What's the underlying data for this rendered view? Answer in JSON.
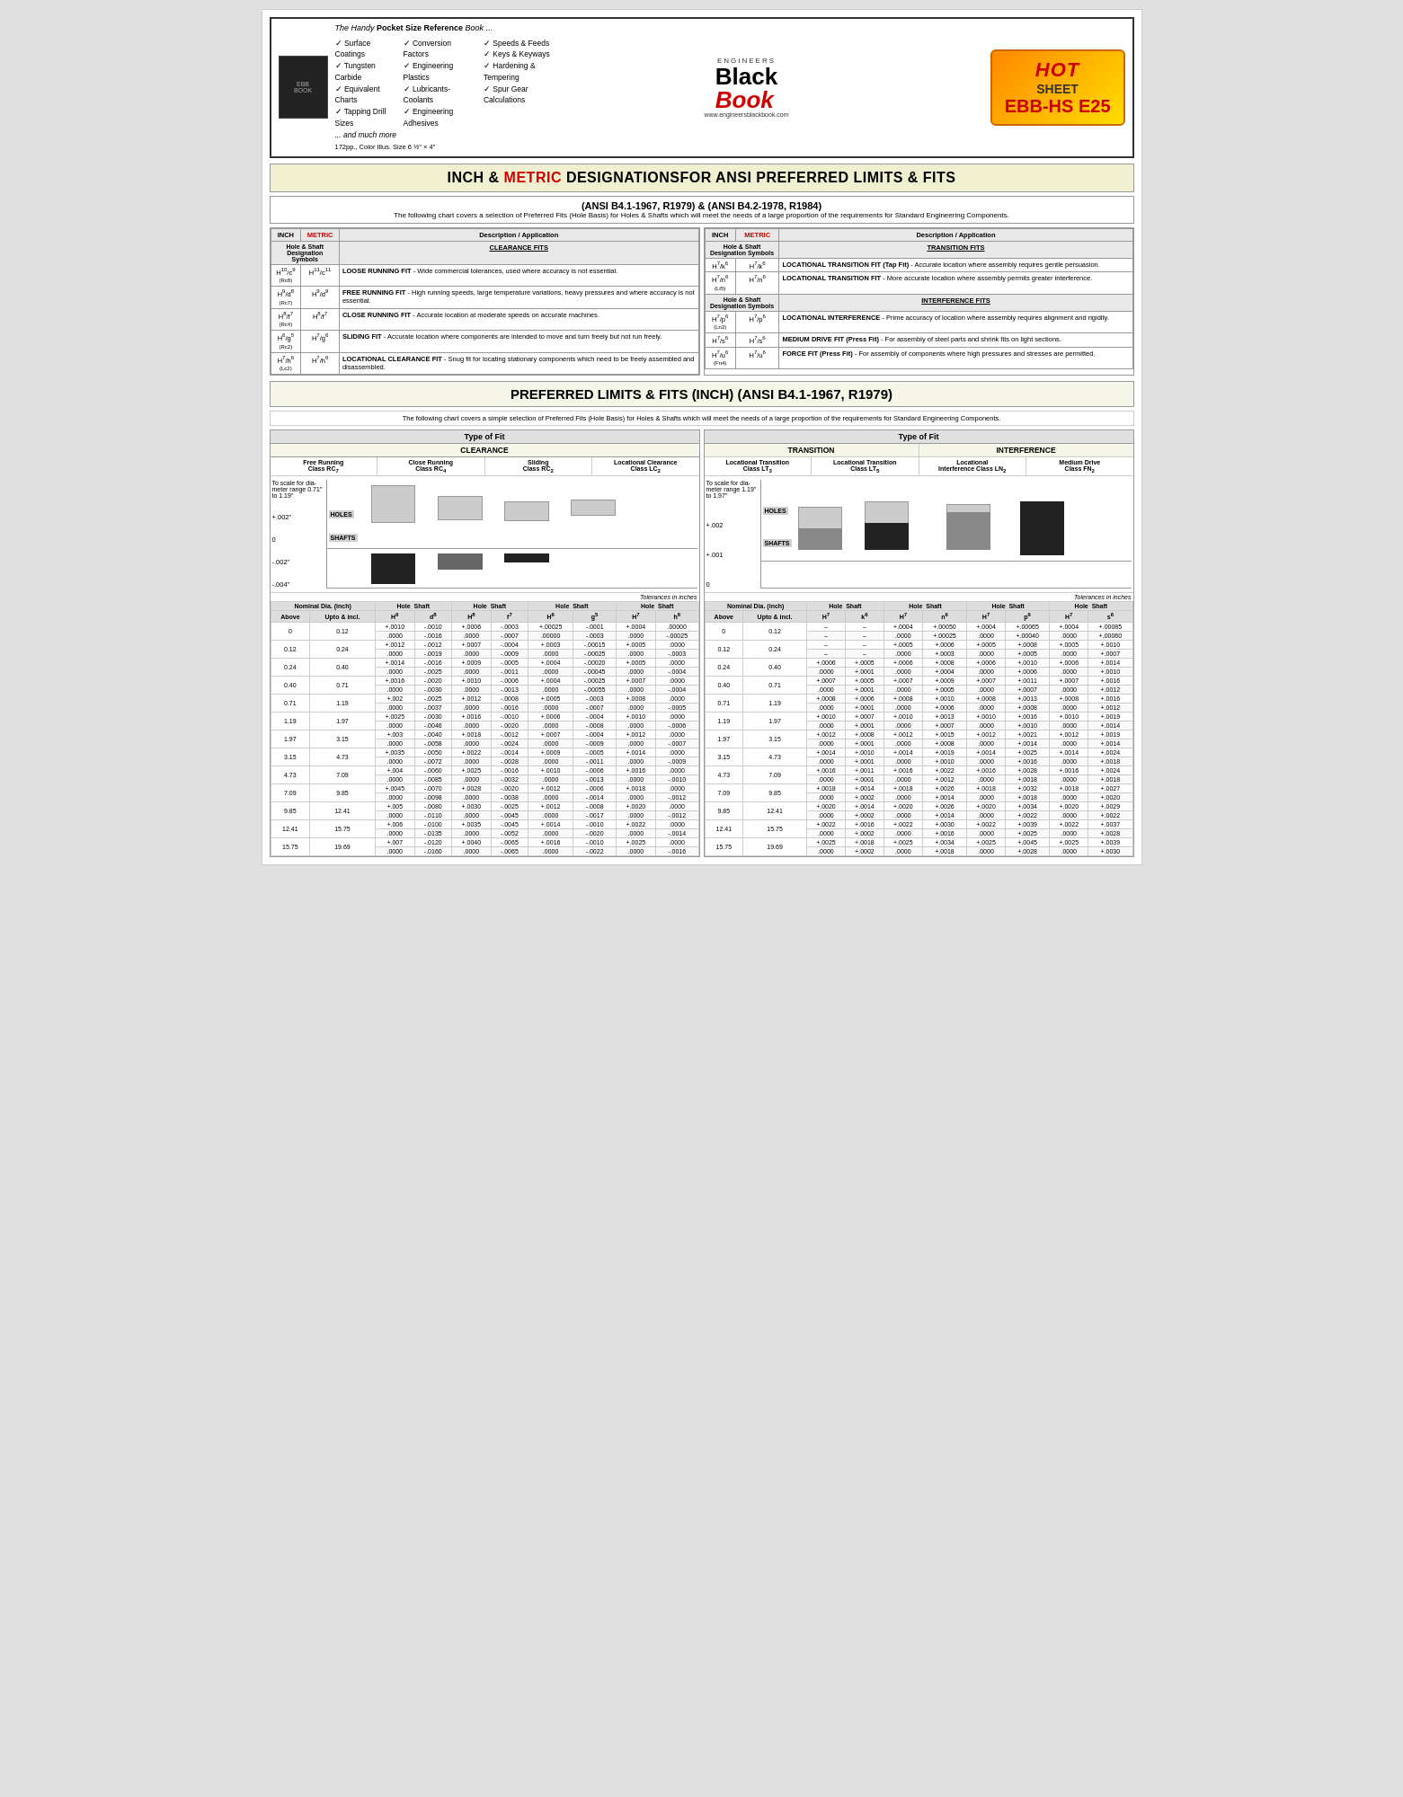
{
  "header": {
    "book_title": "The Handy Pocket Size Reference Book ...",
    "handy": "The Handy",
    "pocket": "Pocket Size Reference",
    "book": "Book",
    "col1": [
      "Surface Coatings",
      "Tungsten Carbide",
      "Equivalent Charts",
      "Tapping Drill Sizes"
    ],
    "col2": [
      "Conversion Factors",
      "Engineering Plastics",
      "Lubricants-Coolants",
      "Engineering Adhesives"
    ],
    "col3": [
      "Speeds & Feeds",
      "Keys & Keyways",
      "Hardening & Tempering",
      "Spur Gear Calculations"
    ],
    "col4_more": "... and much more",
    "pages": "172pp., Color Illus. Size 6 ½\" × 4\"",
    "engineers": "ENGINEERS",
    "black": "Black",
    "book_logo": "Book",
    "website": "www.engineersblackbook.com",
    "hot": "HOT",
    "sheet": "SHEET",
    "ebb": "EBB-HS E25"
  },
  "main_title": {
    "part1": "INCH & ",
    "metric": "METRIC",
    "part2": "  DESIGNATIONS",
    "part3": "FOR ANSI PREFERRED LIMITS & FITS"
  },
  "ansi_header": {
    "line1": "(ANSI B4.1-1967, R1979) & (ANSI B4.2-1978, R1984)",
    "line2": "The following chart covers a selection of Preferred Fits (Hole Basis) for Holes & Shafts which will meet the needs of a large proportion of the requirements for Standard Engineering Components."
  },
  "clearance_table": {
    "col_headers": [
      "INCH",
      "METRIC",
      "Description / Application"
    ],
    "header": "CLEARANCE FITS",
    "rows": [
      {
        "inch1": "H10/c9",
        "inch2": "(Rc8)",
        "metric1": "H11/c11",
        "desc": "LOOSE RUNNING FIT - Wide commercial tolerances, used where accuracy is not essential."
      },
      {
        "inch1": "H9/d8",
        "inch2": "(Rc7)",
        "metric1": "H9/d9",
        "desc": "FREE RUNNING FIT - High running speeds, large temperature variations, heavy pressures and where accuracy is not essential."
      },
      {
        "inch1": "H8/f7",
        "inch2": "(Rc4)",
        "metric1": "H8/f7",
        "desc": "CLOSE RUNNING FIT - Accurate location at moderate speeds on accurate machines."
      },
      {
        "inch1": "H6/g5",
        "inch2": "(Rc2)",
        "metric1": "H7/g6",
        "desc": "SLIDING FIT - Accurate location where components are intended to move and turn freely but not run freely."
      },
      {
        "inch1": "H7/h6",
        "inch2": "(Lc2)",
        "metric1": "H7/h6",
        "desc": "LOCATIONAL CLEARANCE FIT - Snug fit for locating stationary components which need to be freely assembled and disassembled."
      }
    ]
  },
  "transition_table": {
    "header": "TRANSITION FITS",
    "rows": [
      {
        "inch1": "H7/k6",
        "inch2": "",
        "metric1": "H7/k6",
        "desc": "LOCATIONAL TRANSITION FIT (Tap Fit) - Accurate location where assembly requires gentle persuasion."
      },
      {
        "inch1": "H7/n6",
        "inch2": "(Lt5)",
        "metric1": "H7/n6",
        "desc": "LOCATIONAL TRANSITION FIT - More accurate location where assembly permits greater interference."
      }
    ]
  },
  "interference_table": {
    "header": "INTERFERENCE FITS",
    "rows": [
      {
        "inch1": "H7/p6",
        "inch2": "(Ln2)",
        "metric1": "H7/p6",
        "desc": "LOCATIONAL INTERFERENCE - Prime accuracy of location where assembly requires alignment and rigidity."
      },
      {
        "inch1": "H7/s6",
        "inch2": "",
        "metric1": "H7/s6",
        "desc": "MEDIUM DRIVE FIT (Press Fit) - For assembly of steel parts and shrink fits on light sections."
      },
      {
        "inch1": "H7/u6",
        "inch2": "(Fn4)",
        "metric1": "H7/u6",
        "desc": "FORCE FIT (Press Fit) - For assembly of components where high pressures and stresses are permitted."
      }
    ]
  },
  "pref_title": "PREFERRED LIMITS & FITS    (INCH) (ANSI B4.1-1967, R1979)",
  "pref_desc": "The following chart covers a simple selection of Preferred Fits (Hole Basis) for Holes & Shafts which will meet the needs of a large proportion of the requirements for Standard Engineering Components.",
  "left_type": {
    "type": "CLEARANCE",
    "sub1": "Free Running Class RC7",
    "sub2": "Close Running Class RC4",
    "sub3": "Sliding Class RC2",
    "sub4": "Locational Clearance Class LC2",
    "scale_desc": "To scale for diameter range 0.71\" to 1.19\"",
    "y_labels": [
      "+.002\"",
      "0",
      "-.002\"",
      "-.004\""
    ],
    "holes_label": "HOLES",
    "shafts_label": "SHAFTS"
  },
  "right_type": {
    "type1": "TRANSITION",
    "type2": "INTERFERENCE",
    "sub1": "Locational Transition Class LT3",
    "sub2": "Locational Transition Class LT5",
    "sub3": "Locational Interference Class LN2",
    "sub4": "Medium Drive Class FN2",
    "scale_desc": "To scale for diameter range 1.19\" to 1.97\"",
    "y_labels": [
      "+.002",
      "+.001",
      "0"
    ],
    "holes_label": "HOLES",
    "shafts_label": "SHAFTS"
  },
  "tol_label": "Tolerances in inches",
  "left_col_headers": [
    "Nominal Dia. (inch)",
    "",
    "Hole",
    "Shaft",
    "Hole",
    "Shaft",
    "Hole",
    "Shaft",
    "Hole",
    "Shaft"
  ],
  "left_col_sub": [
    "Above",
    "Upto & incl.",
    "H9",
    "d8",
    "H8",
    "f7",
    "H6",
    "g5",
    "H7",
    "h6"
  ],
  "right_col_sub": [
    "Above",
    "Upto & incl.",
    "H7",
    "k6",
    "H7",
    "n6",
    "H7",
    "p6",
    "H7",
    "s6"
  ],
  "left_data": [
    [
      "0",
      "0.12",
      "+.0010",
      "-.0010",
      "+.0006",
      "-.0003",
      "+.00025",
      "-.0001",
      "+.0004",
      ".00000"
    ],
    [
      "",
      "",
      ".0000",
      "-.0016",
      ".0000",
      "-.0007",
      ".00000",
      "-.0003",
      ".0000",
      "-.00025"
    ],
    [
      "0.12",
      "0.24",
      "+.0012",
      "-.0012",
      "+.0007",
      "-.0004",
      "+.0003",
      "-.00015",
      "+.0005",
      ".0000"
    ],
    [
      "",
      "",
      ".0000",
      "-.0019",
      ".0000",
      "-.0009",
      ".0000",
      "-.00025",
      ".0000",
      "-.0003"
    ],
    [
      "0.24",
      "0.40",
      "+.0014",
      "-.0016",
      "+.0009",
      "-.0005",
      "+.0004",
      "-.00020",
      "+.0005",
      ".0000"
    ],
    [
      "",
      "",
      ".0000",
      "-.0025",
      ".0000",
      "-.0011",
      ".0000",
      "-.00045",
      ".0000",
      "-.0004"
    ],
    [
      "0.40",
      "0.71",
      "+.0016",
      "-.0020",
      "+.0010",
      "-.0006",
      "+.0004",
      "-.00025",
      "+.0007",
      ".0000"
    ],
    [
      "",
      "",
      ".0000",
      "-.0030",
      ".0000",
      "-.0013",
      ".0000",
      "-.00055",
      ".0000",
      "-.0004"
    ],
    [
      "0.71",
      "1.19",
      "+.002",
      "-.0025",
      "+.0012",
      "-.0008",
      "+.0005",
      "-.0003",
      "+.0008",
      ".0000"
    ],
    [
      "",
      "",
      ".0000",
      "-.0037",
      ".0000",
      "-.0016",
      ".0000",
      "-.0007",
      ".0000",
      "-.0005"
    ],
    [
      "1.19",
      "1.97",
      "+.0025",
      "-.0030",
      "+.0016",
      "-.0010",
      "+.0006",
      "-.0004",
      "+.0010",
      ".0000"
    ],
    [
      "",
      "",
      ".0000",
      "-.0046",
      ".0000",
      "-.0020",
      ".0000",
      "-.0008",
      ".0000",
      "-.0006"
    ],
    [
      "1.97",
      "3.15",
      "+.003",
      "-.0040",
      "+.0018",
      "-.0012",
      "+.0007",
      "-.0004",
      "+.0012",
      ".0000"
    ],
    [
      "",
      "",
      ".0000",
      "-.0058",
      ".0000",
      "-.0024",
      ".0000",
      "-.0009",
      ".0000",
      "-.0007"
    ],
    [
      "3.15",
      "4.73",
      "+.0035",
      "-.0050",
      "+.0022",
      "-.0014",
      "+.0009",
      "-.0005",
      "+.0014",
      ".0000"
    ],
    [
      "",
      "",
      ".0000",
      "-.0072",
      ".0000",
      "-.0028",
      ".0000",
      "-.0011",
      ".0000",
      "-.0009"
    ],
    [
      "4.73",
      "7.09",
      "+.004",
      "-.0060",
      "+.0025",
      "-.0016",
      "+.0010",
      "-.0006",
      "+.0016",
      ".0000"
    ],
    [
      "",
      "",
      ".0000",
      "-.0085",
      ".0000",
      "-.0032",
      ".0000",
      "-.0013",
      ".0000",
      "-.0010"
    ],
    [
      "7.09",
      "9.85",
      "+.0045",
      "-.0070",
      "+.0028",
      "-.0020",
      "+.0012",
      "-.0006",
      "+.0018",
      ".0000"
    ],
    [
      "",
      "",
      ".0000",
      "-.0098",
      ".0000",
      "-.0038",
      ".0000",
      "-.0014",
      ".0000",
      "-.0012"
    ],
    [
      "9.85",
      "12.41",
      "+.005",
      "-.0080",
      "+.0030",
      "-.0025",
      "+.0012",
      "-.0008",
      "+.0020",
      ".0000"
    ],
    [
      "",
      "",
      ".0000",
      "-.0110",
      ".0000",
      "-.0045",
      ".0000",
      "-.0017",
      ".0000",
      "-.0012"
    ],
    [
      "12.41",
      "15.75",
      "+.006",
      "-.0100",
      "+.0035",
      "-.0045",
      "+.0014",
      "-.0010",
      "+.0022",
      ".0000"
    ],
    [
      "",
      "",
      ".0000",
      "-.0135",
      ".0000",
      "-.0052",
      ".0000",
      "-.0020",
      ".0000",
      "-.0014"
    ],
    [
      "15.75",
      "19.69",
      "+.007",
      "-.0120",
      "+.0040",
      "-.0065",
      "+.0016",
      "-.0010",
      "+.0025",
      ".0000"
    ],
    [
      "",
      "",
      ".0000",
      "-.0160",
      ".0000",
      "-.0065",
      ".0000",
      "-.0022",
      ".0000",
      "-.0016"
    ]
  ],
  "right_data": [
    [
      "0",
      "0.12",
      "–",
      "–",
      "+.0004",
      "+.00050",
      "+.0004",
      "+.00065",
      "+.0004",
      "+.00085"
    ],
    [
      "",
      "",
      "–",
      "–",
      ".0000",
      "+.00025",
      ".0000",
      "+.00040",
      ".0000",
      "+.00060"
    ],
    [
      "0.12",
      "0.24",
      "–",
      "–",
      "+.0005",
      "+.0006",
      "+.0005",
      "+.0008",
      "+.0005",
      "+.0010"
    ],
    [
      "",
      "",
      "–",
      "–",
      ".0000",
      "+.0003",
      ".0000",
      "+.0005",
      ".0000",
      "+.0007"
    ],
    [
      "0.24",
      "0.40",
      "+.0006",
      "+.0005",
      "+.0006",
      "+.0008",
      "+.0006",
      "+.0010",
      "+.0006",
      "+.0014"
    ],
    [
      "",
      "",
      ".0000",
      "+.0001",
      ".0000",
      "+.0004",
      ".0000",
      "+.0006",
      ".0000",
      "+.0010"
    ],
    [
      "0.40",
      "0.71",
      "+.0007",
      "+.0005",
      "+.0007",
      "+.0009",
      "+.0007",
      "+.0011",
      "+.0007",
      "+.0016"
    ],
    [
      "",
      "",
      ".0000",
      "+.0001",
      ".0000",
      "+.0005",
      ".0000",
      "+.0007",
      ".0000",
      "+.0012"
    ],
    [
      "0.71",
      "1.19",
      "+.0008",
      "+.0006",
      "+.0008",
      "+.0010",
      "+.0008",
      "+.0013",
      "+.0008",
      "+.0016"
    ],
    [
      "",
      "",
      ".0000",
      "+.0001",
      ".0000",
      "+.0006",
      ".0000",
      "+.0008",
      ".0000",
      "+.0012"
    ],
    [
      "1.19",
      "1.97",
      "+.0010",
      "+.0007",
      "+.0010",
      "+.0013",
      "+.0010",
      "+.0016",
      "+.0010",
      "+.0019"
    ],
    [
      "",
      "",
      ".0000",
      "+.0001",
      ".0000",
      "+.0007",
      ".0000",
      "+.0010",
      ".0000",
      "+.0014"
    ],
    [
      "1.97",
      "3.15",
      "+.0012",
      "+.0008",
      "+.0012",
      "+.0015",
      "+.0012",
      "+.0021",
      "+.0012",
      "+.0019"
    ],
    [
      "",
      "",
      ".0000",
      "+.0001",
      ".0000",
      "+.0008",
      ".0000",
      "+.0014",
      ".0000",
      "+.0014"
    ],
    [
      "3.15",
      "4.73",
      "+.0014",
      "+.0010",
      "+.0014",
      "+.0019",
      "+.0014",
      "+.0025",
      "+.0014",
      "+.0024"
    ],
    [
      "",
      "",
      ".0000",
      "+.0001",
      ".0000",
      "+.0010",
      ".0000",
      "+.0016",
      ".0000",
      "+.0018"
    ],
    [
      "4.73",
      "7.09",
      "+.0016",
      "+.0011",
      "+.0016",
      "+.0022",
      "+.0016",
      "+.0028",
      "+.0016",
      "+.0024"
    ],
    [
      "",
      "",
      ".0000",
      "+.0001",
      ".0000",
      "+.0012",
      ".0000",
      "+.0018",
      ".0000",
      "+.0018"
    ],
    [
      "7.09",
      "9.85",
      "+.0018",
      "+.0014",
      "+.0018",
      "+.0026",
      "+.0018",
      "+.0032",
      "+.0018",
      "+.0027"
    ],
    [
      "",
      "",
      ".0000",
      "+.0002",
      ".0000",
      "+.0014",
      ".0000",
      "+.0018",
      ".0000",
      "+.0020"
    ],
    [
      "9.85",
      "12.41",
      "+.0020",
      "+.0014",
      "+.0020",
      "+.0026",
      "+.0020",
      "+.0034",
      "+.0020",
      "+.0029"
    ],
    [
      "",
      "",
      ".0000",
      "+.0002",
      ".0000",
      "+.0014",
      ".0000",
      "+.0022",
      ".0000",
      "+.0022"
    ],
    [
      "12.41",
      "15.75",
      "+.0022",
      "+.0016",
      "+.0022",
      "+.0030",
      "+.0022",
      "+.0039",
      "+.0022",
      "+.0037"
    ],
    [
      "",
      "",
      ".0000",
      "+.0002",
      ".0000",
      "+.0016",
      ".0000",
      "+.0025",
      ".0000",
      "+.0028"
    ],
    [
      "15.75",
      "19.69",
      "+.0025",
      "+.0018",
      "+.0025",
      "+.0034",
      "+.0025",
      "+.0045",
      "+.0025",
      "+.0039"
    ],
    [
      "",
      "",
      ".0000",
      "+.0002",
      ".0000",
      "+.0018",
      ".0000",
      "+.0028",
      ".0000",
      "+.0030"
    ]
  ]
}
